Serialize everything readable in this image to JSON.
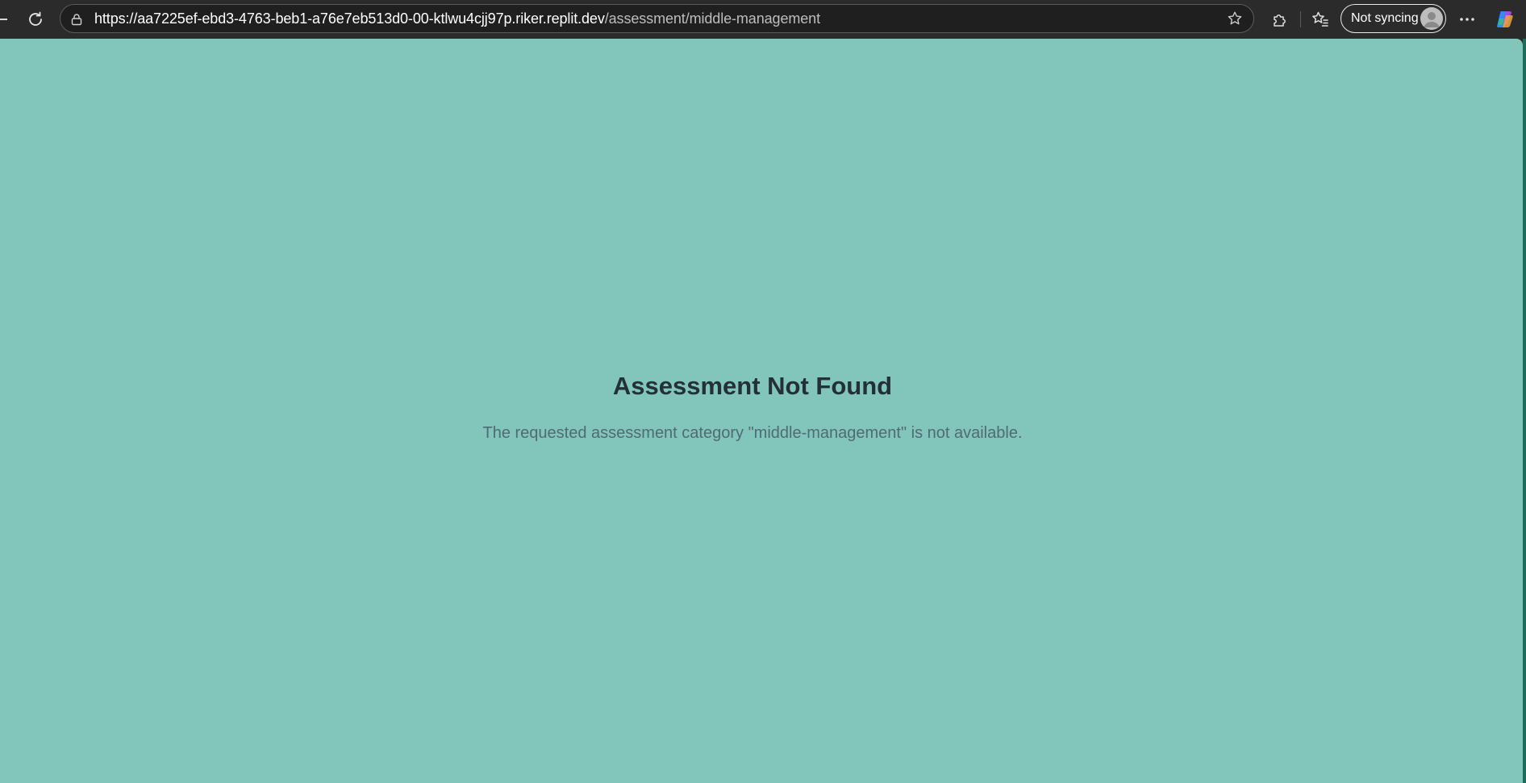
{
  "browser": {
    "url": {
      "host_part": "https://aa7225ef-ebd3-4763-beb1-a76e7eb513d0-00-ktlwu4cjj97p.riker.replit.dev",
      "path_part": "/assessment/middle-management"
    },
    "sync_label": "Not syncing",
    "icons": [
      "back-icon",
      "refresh-icon",
      "lock-icon",
      "star-icon",
      "extensions-icon",
      "favorites-icon",
      "avatar-icon",
      "more-icon",
      "copilot-icon"
    ]
  },
  "page": {
    "background_color": "#82c5bb",
    "title": "Assessment Not Found",
    "message": "The requested assessment category \"middle-management\" is not available."
  }
}
